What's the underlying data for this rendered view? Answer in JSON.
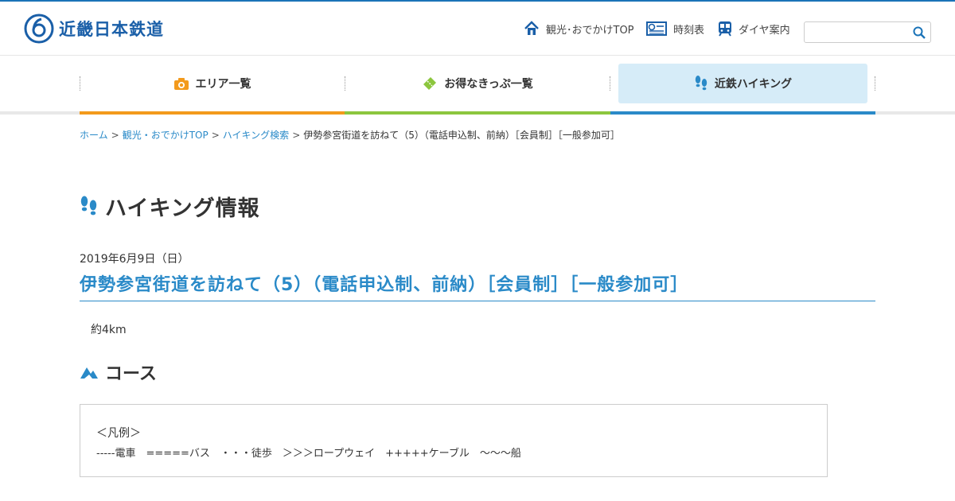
{
  "header": {
    "logo_text": "近畿日本鉄道",
    "util": {
      "top_label": "観光･おでかけTOP",
      "timetable_label": "時刻表",
      "dia_label": "ダイヤ案内"
    },
    "search": {
      "placeholder": "",
      "value": ""
    }
  },
  "gnav": {
    "items": [
      {
        "label": "エリア一覧",
        "icon": "camera-icon",
        "color": "#f39a1c"
      },
      {
        "label": "お得なきっぷ一覧",
        "icon": "ticket-icon",
        "color": "#8cc63e"
      },
      {
        "label": "近鉄ハイキング",
        "icon": "footprints-icon",
        "color": "#2a8ac8",
        "active": true
      }
    ]
  },
  "breadcrumb": {
    "items": [
      "ホーム",
      "観光・おでかけTOP",
      "ハイキング検索"
    ],
    "current": "伊勢参宮街道を訪ねて（5）（電話申込制、前納）［会員制］［一般参加可］"
  },
  "main": {
    "page_title": "ハイキング情報",
    "event_date": "2019年6月9日（日）",
    "event_title": "伊勢参宮街道を訪ねて（5）（電話申込制、前納）［会員制］［一般参加可］",
    "distance": "約4km",
    "course_title": "コース",
    "legend": {
      "head": "＜凡例＞",
      "line": "-----電車　=====バス　・・・徒歩　＞＞＞ロープウェイ　+++++ケーブル　〜〜〜船"
    }
  },
  "colors": {
    "brand": "#1a5fa8",
    "accent": "#2a8ac8",
    "nav_active_bg": "#d6ecf8"
  }
}
